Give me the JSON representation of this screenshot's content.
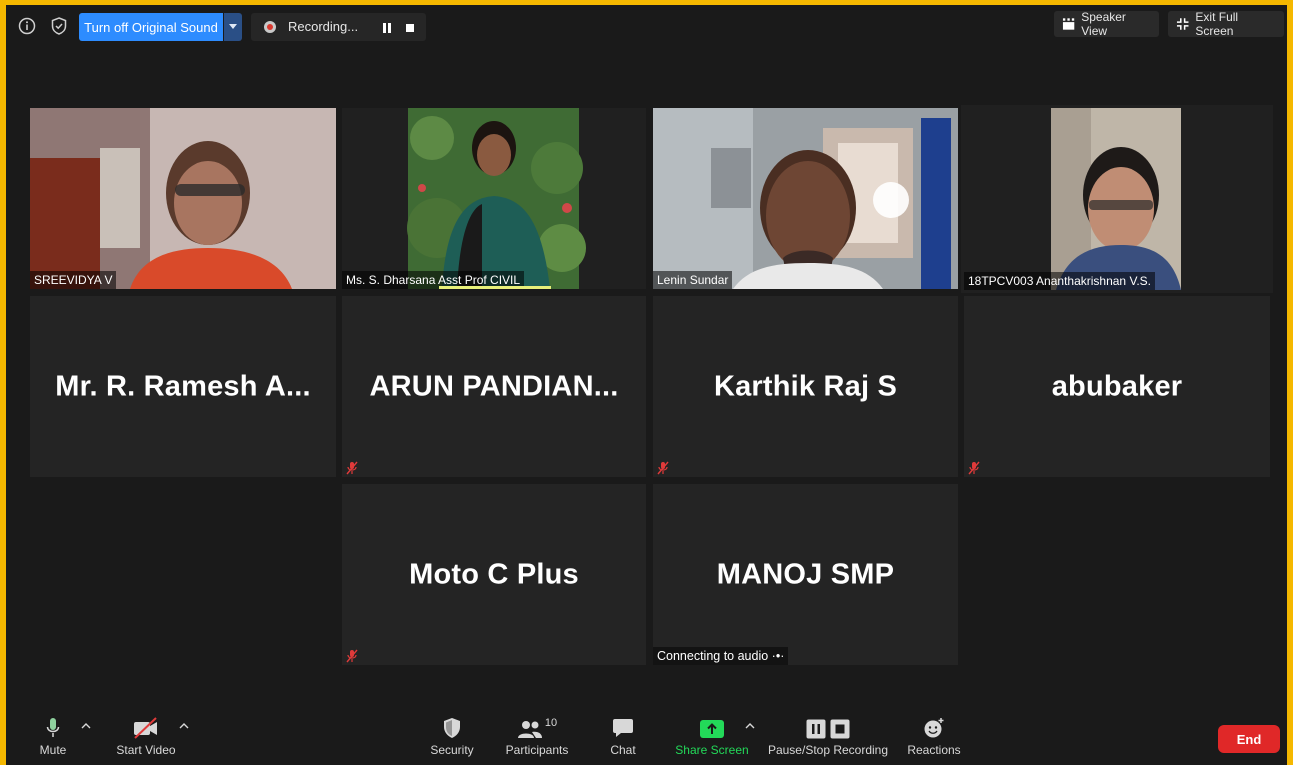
{
  "topbar": {
    "original_sound_label": "Turn off Original Sound",
    "recording_label": "Recording...",
    "speaker_view_label": "Speaker View",
    "exit_fullscreen_label": "Exit Full Screen"
  },
  "participants": {
    "video_tiles": [
      {
        "name": "SREEVIDYA V"
      },
      {
        "name": "Ms. S. Dharsana Asst Prof CIVIL"
      },
      {
        "name": "Lenin Sundar"
      },
      {
        "name": "18TPCV003 Ananthakrishnan V.S."
      }
    ],
    "name_tiles": [
      {
        "name": "Mr. R. Ramesh A..."
      },
      {
        "name": "ARUN  PANDIAN..."
      },
      {
        "name": "Karthik Raj S"
      },
      {
        "name": "abubaker"
      },
      {
        "name": "Moto C Plus"
      },
      {
        "name": "MANOJ SMP",
        "status": "Connecting to audio ·•·"
      }
    ]
  },
  "toolbar": {
    "mute_label": "Mute",
    "start_video_label": "Start Video",
    "security_label": "Security",
    "participants_label": "Participants",
    "participants_count": "10",
    "chat_label": "Chat",
    "share_screen_label": "Share Screen",
    "recording_label": "Pause/Stop Recording",
    "reactions_label": "Reactions",
    "end_label": "End"
  },
  "colors": {
    "frame": "#f5b800",
    "accent_blue": "#2d8cff",
    "share_green": "#23d959",
    "end_red": "#e02828",
    "active_speaker": "#d9e77a"
  }
}
